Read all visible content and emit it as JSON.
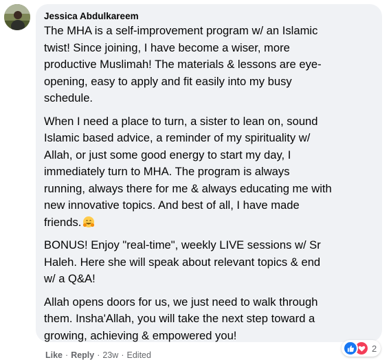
{
  "comment": {
    "author": "Jessica Abdulkareem",
    "paragraphs": [
      "The MHA is a self-improvement program w/ an Islamic\ntwist! Since joining, I have become a wiser, more\nproductive Muslimah! The materials & lessons are eye-\nopening, easy to apply and fit easily into my busy\nschedule.",
      "When I need a place to turn, a sister to lean on, sound\nIslamic based advice, a reminder of my spirituality w/\nAllah, or just some good energy to start my day, I\nimmediately turn to MHA. The program is always\nrunning, always there for me & always educating me with\nnew innovative topics. And best of all, I have made\nfriends.",
      "BONUS! Enjoy \"real-time\", weekly LIVE sessions w/ Sr\nHaleh. Here she will speak about relevant topics & end\nw/ a Q&A!",
      "Allah opens doors for us, we just need to walk through\nthem. Insha'Allah, you will take the next step toward a\ngrowing, achieving & empowered you!"
    ],
    "emoji_icon": "hugging-face-emoji"
  },
  "reactions": {
    "icons": [
      "like-icon",
      "love-icon"
    ],
    "count": "2",
    "colors": {
      "like": "#1877f2",
      "love": "#f33e58"
    }
  },
  "actions": {
    "like": "Like",
    "reply": "Reply",
    "separator": "·",
    "time": "23w",
    "edited": "Edited"
  },
  "colors": {
    "bubble": "#f0f2f5",
    "text": "#050505",
    "secondary": "#65676b"
  }
}
